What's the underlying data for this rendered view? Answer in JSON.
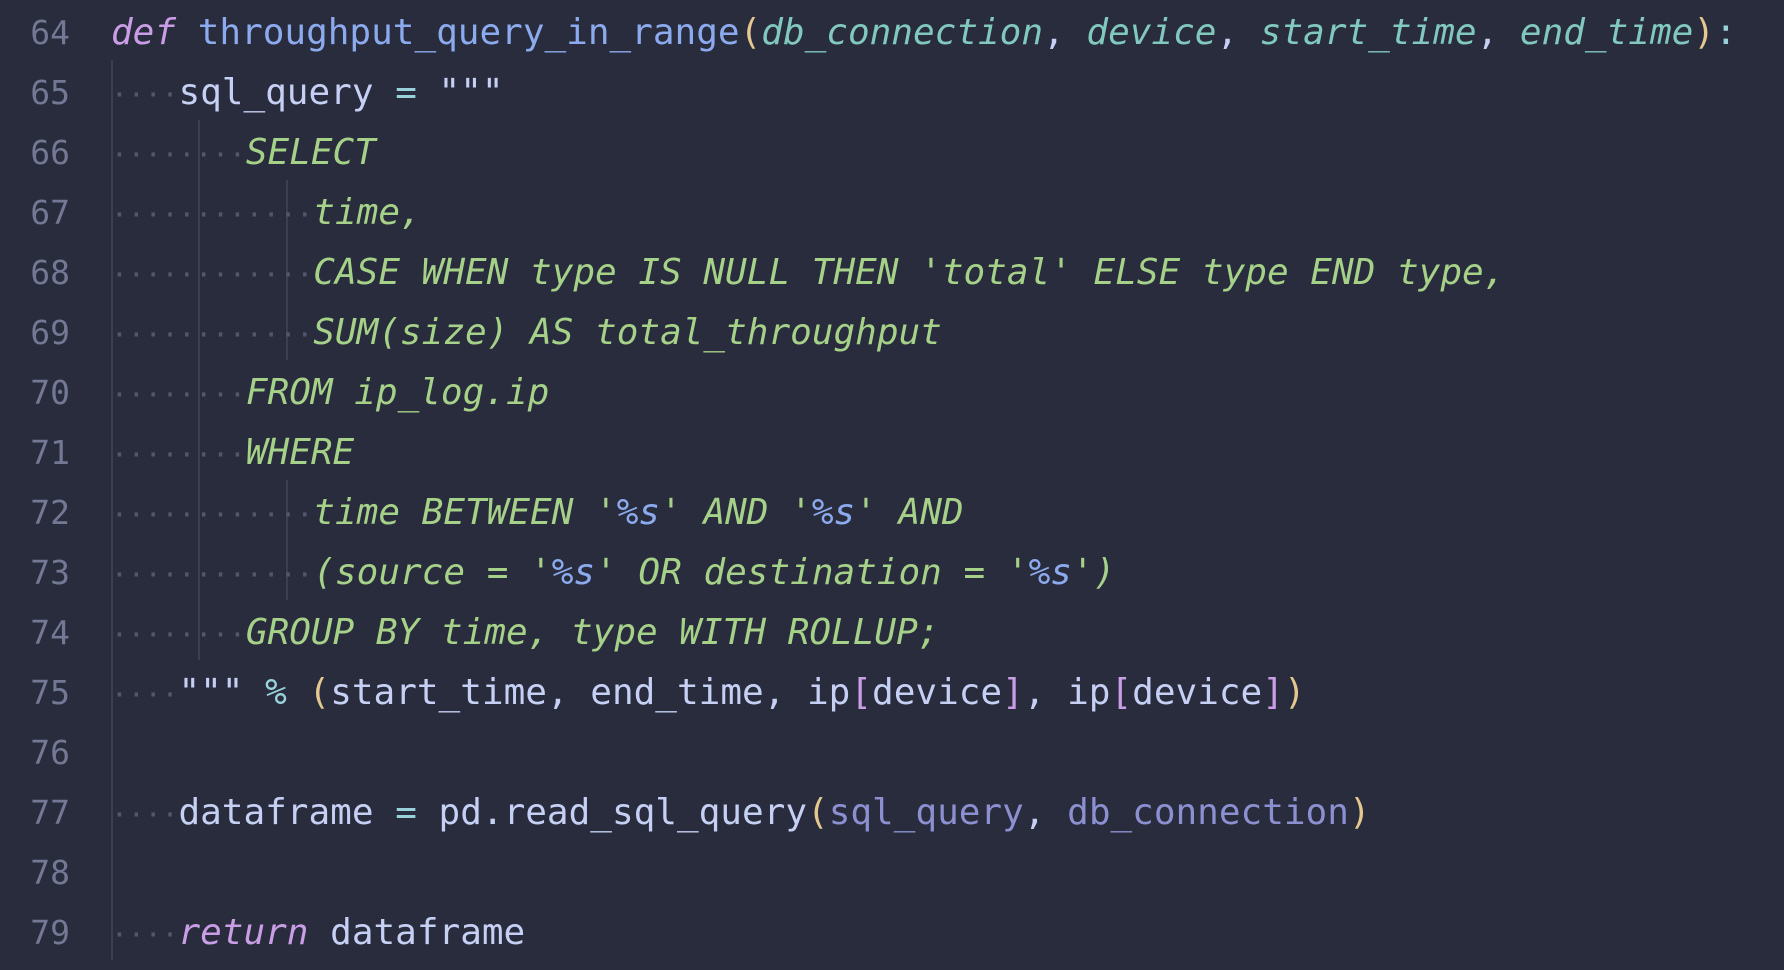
{
  "editor": {
    "colors": {
      "background": "#292c3c",
      "line_number": "#737994",
      "keyword": "#ca9ee6",
      "function": "#8caaee",
      "parameter": "#81c8be",
      "string": "#a6d189",
      "bracket": "#e5c890",
      "text": "#c6d0f5"
    },
    "lines": [
      {
        "num": "64",
        "tokens": [
          {
            "t": "def",
            "c": "kw i"
          },
          {
            "t": " ",
            "c": "pln"
          },
          {
            "t": "throughput_query_in_range",
            "c": "fn"
          },
          {
            "t": "(",
            "c": "brk1"
          },
          {
            "t": "db_connection",
            "c": "par i"
          },
          {
            "t": ", ",
            "c": "pln"
          },
          {
            "t": "device",
            "c": "par i"
          },
          {
            "t": ", ",
            "c": "pln"
          },
          {
            "t": "start_time",
            "c": "par i"
          },
          {
            "t": ", ",
            "c": "pln"
          },
          {
            "t": "end_time",
            "c": "par i"
          },
          {
            "t": ")",
            "c": "brk1"
          },
          {
            "t": ":",
            "c": "op"
          }
        ]
      },
      {
        "num": "65",
        "tokens": [
          {
            "t": "····",
            "c": "ws"
          },
          {
            "t": "sql_query",
            "c": "pln"
          },
          {
            "t": " = ",
            "c": "op"
          },
          {
            "t": "\"\"\"",
            "c": "pln"
          }
        ]
      },
      {
        "num": "66",
        "tokens": [
          {
            "t": "········",
            "c": "ws"
          },
          {
            "t": "SELECT",
            "c": "str i"
          }
        ]
      },
      {
        "num": "67",
        "tokens": [
          {
            "t": "············",
            "c": "ws"
          },
          {
            "t": "time,",
            "c": "str i"
          }
        ]
      },
      {
        "num": "68",
        "tokens": [
          {
            "t": "············",
            "c": "ws"
          },
          {
            "t": "CASE WHEN type IS NULL THEN 'total' ELSE type END type,",
            "c": "str i"
          }
        ]
      },
      {
        "num": "69",
        "tokens": [
          {
            "t": "············",
            "c": "ws"
          },
          {
            "t": "SUM(size) AS total_throughput",
            "c": "str i"
          }
        ]
      },
      {
        "num": "70",
        "tokens": [
          {
            "t": "········",
            "c": "ws"
          },
          {
            "t": "FROM ip_log.ip",
            "c": "str i"
          }
        ]
      },
      {
        "num": "71",
        "tokens": [
          {
            "t": "········",
            "c": "ws"
          },
          {
            "t": "WHERE",
            "c": "str i"
          }
        ]
      },
      {
        "num": "72",
        "tokens": [
          {
            "t": "············",
            "c": "ws"
          },
          {
            "t": "time BETWEEN '",
            "c": "str i"
          },
          {
            "t": "%s",
            "c": "fmt i"
          },
          {
            "t": "' AND '",
            "c": "str i"
          },
          {
            "t": "%s",
            "c": "fmt i"
          },
          {
            "t": "' AND",
            "c": "str i"
          }
        ]
      },
      {
        "num": "73",
        "tokens": [
          {
            "t": "············",
            "c": "ws"
          },
          {
            "t": "(source = '",
            "c": "str i"
          },
          {
            "t": "%s",
            "c": "fmt i"
          },
          {
            "t": "' OR destination = '",
            "c": "str i"
          },
          {
            "t": "%s",
            "c": "fmt i"
          },
          {
            "t": "')",
            "c": "str i"
          }
        ]
      },
      {
        "num": "74",
        "tokens": [
          {
            "t": "········",
            "c": "ws"
          },
          {
            "t": "GROUP BY time, type WITH ROLLUP;",
            "c": "str i"
          }
        ]
      },
      {
        "num": "75",
        "tokens": [
          {
            "t": "····",
            "c": "ws"
          },
          {
            "t": "\"\"\"",
            "c": "pln"
          },
          {
            "t": " % ",
            "c": "op"
          },
          {
            "t": "(",
            "c": "brk1"
          },
          {
            "t": "start_time, end_time, ip",
            "c": "pln"
          },
          {
            "t": "[",
            "c": "brk2"
          },
          {
            "t": "device",
            "c": "pln"
          },
          {
            "t": "]",
            "c": "brk2"
          },
          {
            "t": ", ip",
            "c": "pln"
          },
          {
            "t": "[",
            "c": "brk2"
          },
          {
            "t": "device",
            "c": "pln"
          },
          {
            "t": "]",
            "c": "brk2"
          },
          {
            "t": ")",
            "c": "brk1"
          }
        ]
      },
      {
        "num": "76",
        "tokens": []
      },
      {
        "num": "77",
        "tokens": [
          {
            "t": "····",
            "c": "ws"
          },
          {
            "t": "dataframe",
            "c": "pln"
          },
          {
            "t": " = ",
            "c": "op"
          },
          {
            "t": "pd.read_sql_query",
            "c": "pln"
          },
          {
            "t": "(",
            "c": "brk1"
          },
          {
            "t": "sql_query",
            "c": "arg2"
          },
          {
            "t": ", ",
            "c": "pln"
          },
          {
            "t": "db_connection",
            "c": "arg2"
          },
          {
            "t": ")",
            "c": "brk1"
          }
        ]
      },
      {
        "num": "78",
        "tokens": []
      },
      {
        "num": "79",
        "tokens": [
          {
            "t": "····",
            "c": "ws"
          },
          {
            "t": "return",
            "c": "kw i"
          },
          {
            "t": " dataframe",
            "c": "pln"
          }
        ]
      }
    ]
  }
}
